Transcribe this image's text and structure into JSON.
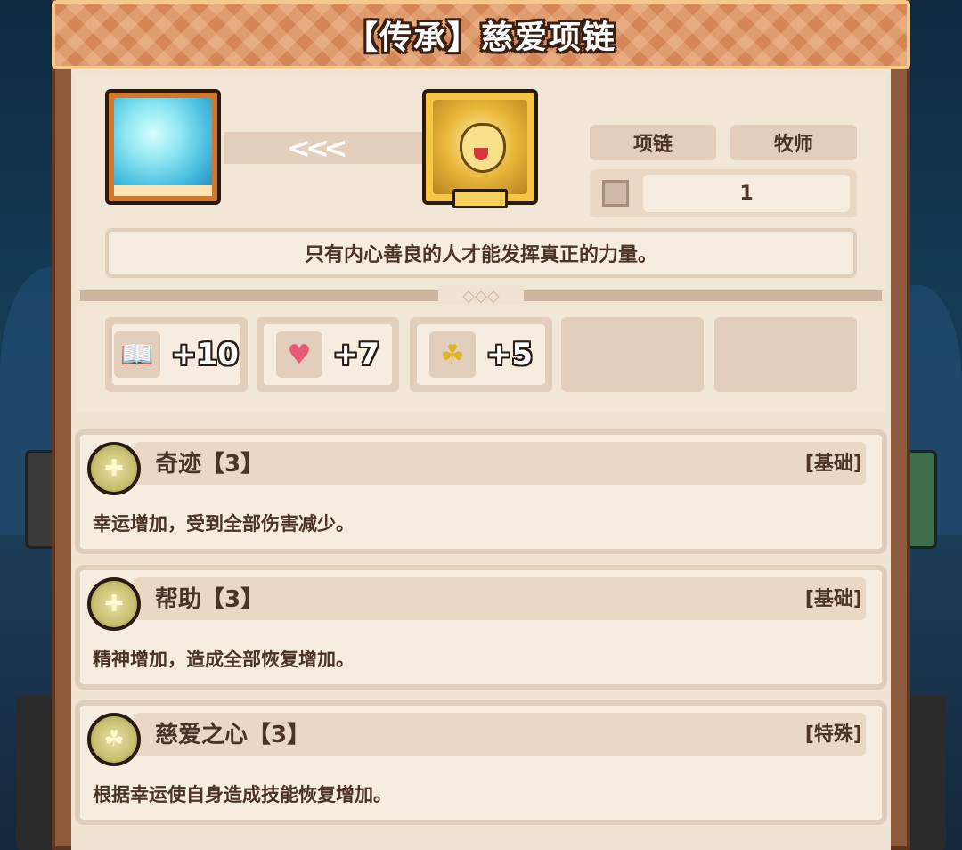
{
  "title": "【传承】慈爱项链",
  "item": {
    "icon_left": "crystal-orb-icon",
    "icon_right": "golden-necklace-icon",
    "arrow_text": "<<<",
    "tags": [
      "项链",
      "牧师"
    ],
    "level": "1",
    "description": "只有内心善良的人才能发挥真正的力量。"
  },
  "stats": [
    {
      "icon": "book-icon",
      "value": "+10"
    },
    {
      "icon": "heart-icon",
      "value": "+7"
    },
    {
      "icon": "clover-icon",
      "value": "+5"
    }
  ],
  "skills": [
    {
      "name": "奇迹【3】",
      "type": "[基础]",
      "description": "幸运增加，受到全部伤害减少。",
      "icon": "cross-badge-icon"
    },
    {
      "name": "帮助【3】",
      "type": "[基础]",
      "description": "精神增加，造成全部恢复增加。",
      "icon": "cross-badge-icon"
    },
    {
      "name": "慈爱之心【3】",
      "type": "[特殊]",
      "description": "根据幸运使自身造成技能恢复增加。",
      "icon": "clover-badge-icon"
    }
  ]
}
